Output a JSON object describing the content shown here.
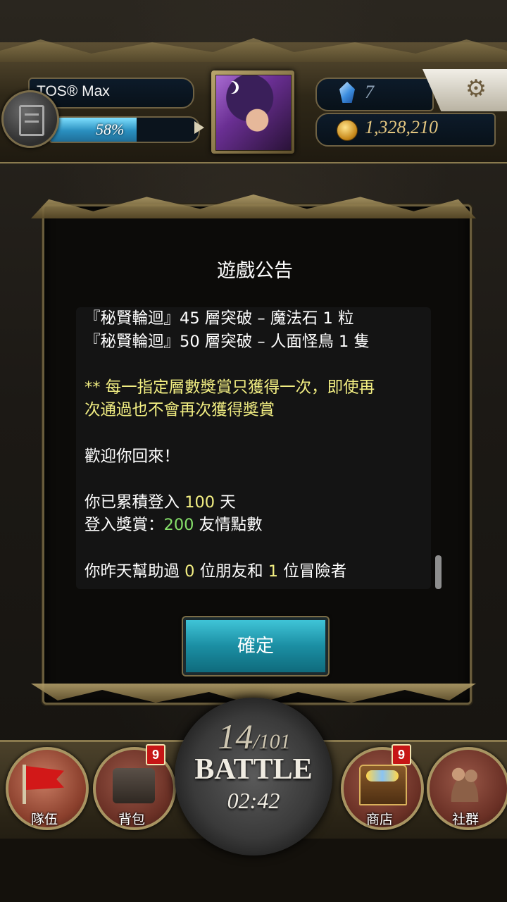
{
  "player": {
    "name": "TOS® Max",
    "exp_percent_label": "58%",
    "exp_fraction": 0.58,
    "gems": "7",
    "coins": "1,328,210"
  },
  "dialog": {
    "title": "遊戲公告",
    "confirm_label": "確定",
    "lines": [
      [
        {
          "t": "『秘賢輪迴』45 層突破 – 魔法石 1 粒"
        }
      ],
      [
        {
          "t": "『秘賢輪迴』50 層突破 – 人面怪鳥 1 隻"
        }
      ],
      [],
      [
        {
          "t": "** 每一指定層數獎賞只獲得一次，即使再",
          "c": "yellow"
        }
      ],
      [
        {
          "t": "次通過也不會再次獲得獎賞",
          "c": "yellow"
        }
      ],
      [],
      [
        {
          "t": "歡迎你回來！"
        }
      ],
      [],
      [
        {
          "t": "你已累積登入 "
        },
        {
          "t": "100",
          "c": "yellow"
        },
        {
          "t": " 天"
        }
      ],
      [
        {
          "t": "登入獎賞："
        },
        {
          "t": "200",
          "c": "green"
        },
        {
          "t": " 友情點數"
        }
      ],
      [],
      [
        {
          "t": "你昨天幫助過 "
        },
        {
          "t": "0",
          "c": "yellow"
        },
        {
          "t": " 位朋友和 "
        },
        {
          "t": "1",
          "c": "yellow"
        },
        {
          "t": " 位冒險者"
        }
      ]
    ]
  },
  "nav": {
    "team_label": "隊伍",
    "bag_label": "背包",
    "bag_badge": "9",
    "shop_label": "商店",
    "shop_badge": "9",
    "social_label": "社群"
  },
  "battle": {
    "current": "14",
    "total": "/101",
    "label": "BATTLE",
    "timer": "02:42"
  },
  "colors": {
    "highlight_yellow": "#f2ee82",
    "highlight_green": "#86e06a",
    "button_teal": "#1b8ea3",
    "badge_red": "#c61616"
  }
}
